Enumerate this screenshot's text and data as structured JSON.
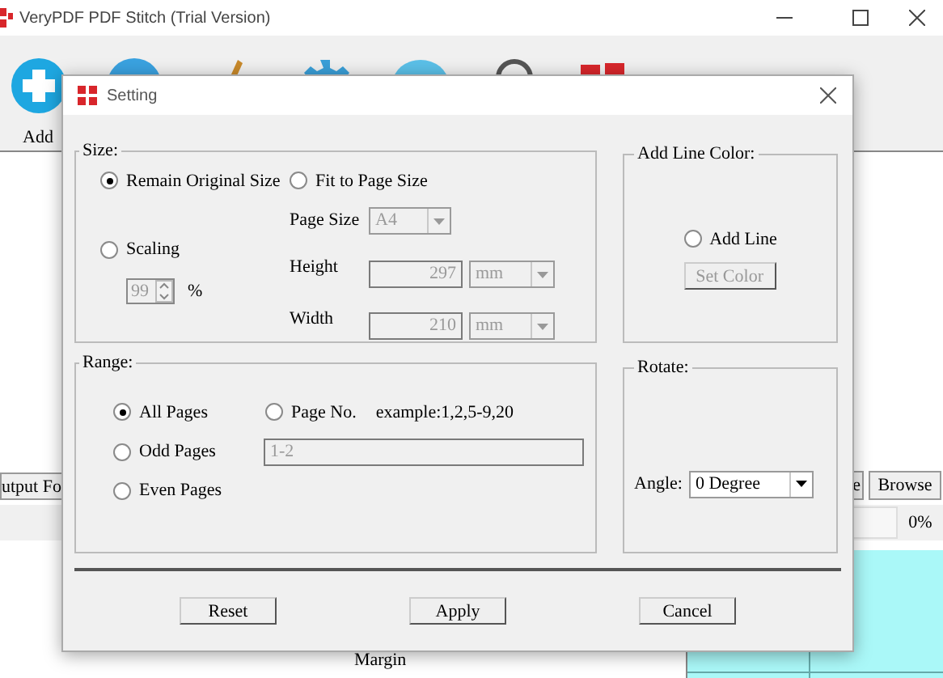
{
  "main_window": {
    "title": "VeryPDF PDF Stitch (Trial Version)",
    "toolbar": [
      {
        "kind": "add",
        "label": "Add"
      },
      {
        "kind": "circle"
      },
      {
        "kind": "brush"
      },
      {
        "kind": "gear"
      },
      {
        "kind": "bubble"
      },
      {
        "kind": "magnifier"
      },
      {
        "kind": "logo"
      }
    ],
    "output_folder_button": "utput Fo",
    "open_button": "e",
    "browse_button": "Browse",
    "progress_text": "0%",
    "margin_label": "Margin"
  },
  "dialog": {
    "title": "Setting",
    "size": {
      "title": "Size:",
      "options": [
        {
          "label": "Remain Original Size",
          "selected": true
        },
        {
          "label": "Fit to Page Size",
          "selected": false
        },
        {
          "label": "Scaling",
          "selected": false
        }
      ],
      "page_size": {
        "label": "Page Size",
        "value": "A4",
        "disabled": true
      },
      "scaling": {
        "value": "99",
        "unit": "%",
        "disabled": true
      },
      "height": {
        "label": "Height",
        "value": "297",
        "unit": "mm",
        "disabled": true
      },
      "width": {
        "label": "Width",
        "value": "210",
        "unit": "mm",
        "disabled": true
      }
    },
    "line_color": {
      "title": "Add Line Color:",
      "add_line": {
        "label": "Add Line",
        "checked": false
      },
      "set_color": {
        "label": "Set Color",
        "disabled": true
      }
    },
    "range": {
      "title": "Range:",
      "options": [
        {
          "label": "All Pages",
          "selected": true
        },
        {
          "label": "Page No.",
          "selected": false
        },
        {
          "label": "Odd Pages",
          "selected": false
        },
        {
          "label": "Even Pages",
          "selected": false
        }
      ],
      "hint": "example:1,2,5-9,20",
      "page_field": {
        "value": "1-2",
        "disabled": true
      }
    },
    "rotate": {
      "title": "Rotate:",
      "angle_label": "Angle:",
      "angle": "0 Degree"
    },
    "buttons": [
      "Reset",
      "Apply",
      "Cancel"
    ]
  }
}
